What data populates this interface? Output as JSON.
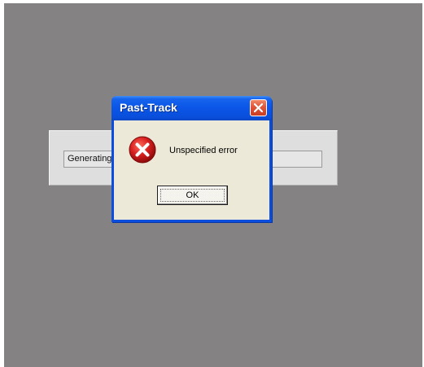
{
  "background_window": {
    "status_text": "Generating"
  },
  "dialog": {
    "title": "Past-Track",
    "message": "Unspecified error",
    "ok_label": "OK",
    "icon": "error-icon",
    "close_icon": "close-icon"
  },
  "colors": {
    "desktop": "#858283",
    "titlebar": "#0b55e6",
    "client": "#ece9d8",
    "error_red": "#d61f1f",
    "close_red": "#e0543a"
  }
}
